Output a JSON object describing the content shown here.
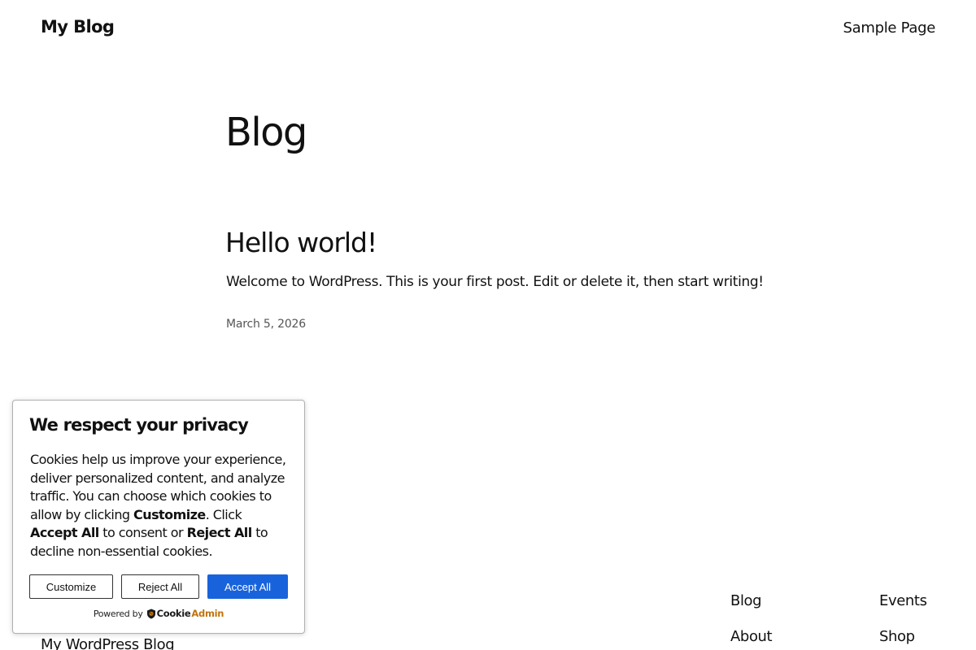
{
  "header": {
    "site_title": "My Blog",
    "nav_items": [
      "Sample Page"
    ]
  },
  "main": {
    "heading": "Blog",
    "post": {
      "title": "Hello world!",
      "excerpt": "Welcome to WordPress. This is your first post. Edit or delete it, then start writing!",
      "date": "March 5, 2026"
    }
  },
  "footer": {
    "site_title": "My WordPress Blog",
    "col1": [
      "Blog",
      "About"
    ],
    "col2": [
      "Events",
      "Shop"
    ]
  },
  "cookie_banner": {
    "title": "We respect your privacy",
    "text_1": "Cookies help us improve your experience, deliver personalized content, and analyze traffic. You can choose which cookies to allow by clicking ",
    "customize_word": "Customize",
    "text_2": ". Click ",
    "accept_word": "Accept All",
    "text_3": " to consent or ",
    "reject_word": "Reject All",
    "text_4": " to decline non-essential cookies.",
    "buttons": {
      "customize": "Customize",
      "reject": "Reject All",
      "accept": "Accept All"
    },
    "powered_by": "Powered by",
    "brand_part_1": "Cookie",
    "brand_part_2": "Admin",
    "brand_icon": "shield-icon",
    "accent_color": "#1863dc",
    "brand_color": "#c0740f"
  }
}
